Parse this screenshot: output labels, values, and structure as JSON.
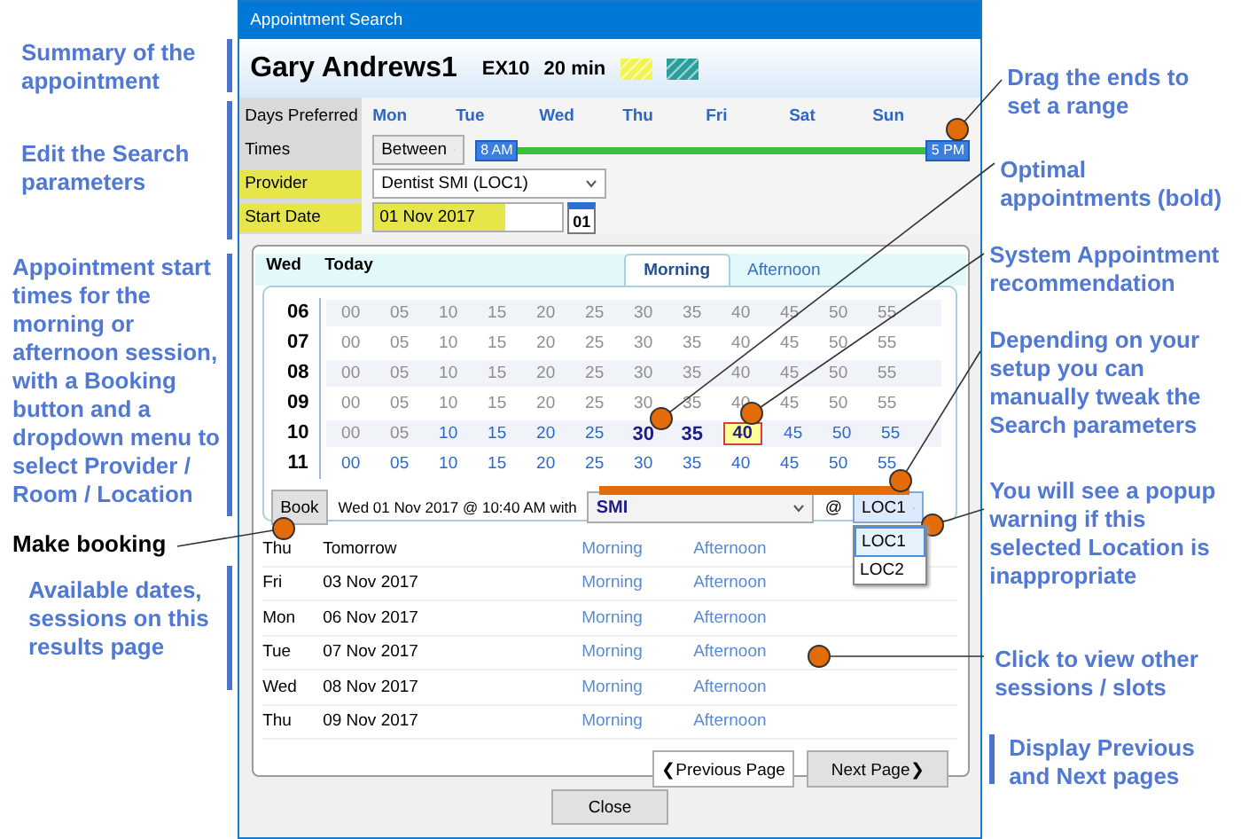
{
  "window": {
    "title": "Appointment Search"
  },
  "summary": {
    "patient": "Gary Andrews1",
    "code": "EX10",
    "duration": "20 min",
    "swatches": [
      {
        "color": "#f2f250"
      },
      {
        "color": "#2a9d9d"
      }
    ]
  },
  "parameters": {
    "days_label": "Days Preferred",
    "days": [
      "Mon",
      "Tue",
      "Wed",
      "Thu",
      "Fri",
      "Sat",
      "Sun"
    ],
    "times_label": "Times",
    "times_mode": "Between",
    "range_start": "8 AM",
    "range_end": "5 PM",
    "provider_label": "Provider",
    "provider_value": "Dentist SMI (LOC1)",
    "provider_highlighted": true,
    "start_date_label": "Start Date",
    "start_date_value": "01 Nov 2017",
    "start_date_highlighted": true,
    "calendar_day": "01"
  },
  "results": {
    "day": "Wed",
    "day_note": "Today",
    "tabs": [
      {
        "label": "Morning",
        "selected": true
      },
      {
        "label": "Afternoon",
        "selected": false
      }
    ],
    "slot_rows": [
      {
        "hour": "06",
        "slots": [
          {
            "minute": "00",
            "kind": "unavailable"
          },
          {
            "minute": "05",
            "kind": "unavailable"
          },
          {
            "minute": "10",
            "kind": "unavailable"
          },
          {
            "minute": "15",
            "kind": "unavailable"
          },
          {
            "minute": "20",
            "kind": "unavailable"
          },
          {
            "minute": "25",
            "kind": "unavailable"
          },
          {
            "minute": "30",
            "kind": "unavailable"
          },
          {
            "minute": "35",
            "kind": "unavailable"
          },
          {
            "minute": "40",
            "kind": "unavailable"
          },
          {
            "minute": "45",
            "kind": "unavailable"
          },
          {
            "minute": "50",
            "kind": "unavailable"
          },
          {
            "minute": "55",
            "kind": "unavailable"
          }
        ]
      },
      {
        "hour": "07",
        "slots": [
          {
            "minute": "00",
            "kind": "unavailable"
          },
          {
            "minute": "05",
            "kind": "unavailable"
          },
          {
            "minute": "10",
            "kind": "unavailable"
          },
          {
            "minute": "15",
            "kind": "unavailable"
          },
          {
            "minute": "20",
            "kind": "unavailable"
          },
          {
            "minute": "25",
            "kind": "unavailable"
          },
          {
            "minute": "30",
            "kind": "unavailable"
          },
          {
            "minute": "35",
            "kind": "unavailable"
          },
          {
            "minute": "40",
            "kind": "unavailable"
          },
          {
            "minute": "45",
            "kind": "unavailable"
          },
          {
            "minute": "50",
            "kind": "unavailable"
          },
          {
            "minute": "55",
            "kind": "unavailable"
          }
        ]
      },
      {
        "hour": "08",
        "slots": [
          {
            "minute": "00",
            "kind": "unavailable"
          },
          {
            "minute": "05",
            "kind": "unavailable"
          },
          {
            "minute": "10",
            "kind": "unavailable"
          },
          {
            "minute": "15",
            "kind": "unavailable"
          },
          {
            "minute": "20",
            "kind": "unavailable"
          },
          {
            "minute": "25",
            "kind": "unavailable"
          },
          {
            "minute": "30",
            "kind": "unavailable"
          },
          {
            "minute": "35",
            "kind": "unavailable"
          },
          {
            "minute": "40",
            "kind": "unavailable"
          },
          {
            "minute": "45",
            "kind": "unavailable"
          },
          {
            "minute": "50",
            "kind": "unavailable"
          },
          {
            "minute": "55",
            "kind": "unavailable"
          }
        ]
      },
      {
        "hour": "09",
        "slots": [
          {
            "minute": "00",
            "kind": "unavailable"
          },
          {
            "minute": "05",
            "kind": "unavailable"
          },
          {
            "minute": "10",
            "kind": "unavailable"
          },
          {
            "minute": "15",
            "kind": "unavailable"
          },
          {
            "minute": "20",
            "kind": "unavailable"
          },
          {
            "minute": "25",
            "kind": "unavailable"
          },
          {
            "minute": "30",
            "kind": "unavailable"
          },
          {
            "minute": "35",
            "kind": "unavailable"
          },
          {
            "minute": "40",
            "kind": "unavailable"
          },
          {
            "minute": "45",
            "kind": "unavailable"
          },
          {
            "minute": "50",
            "kind": "unavailable"
          },
          {
            "minute": "55",
            "kind": "unavailable"
          }
        ]
      },
      {
        "hour": "10",
        "slots": [
          {
            "minute": "00",
            "kind": "unavailable"
          },
          {
            "minute": "05",
            "kind": "unavailable"
          },
          {
            "minute": "10",
            "kind": "available"
          },
          {
            "minute": "15",
            "kind": "available"
          },
          {
            "minute": "20",
            "kind": "available"
          },
          {
            "minute": "25",
            "kind": "available"
          },
          {
            "minute": "30",
            "kind": "optimal"
          },
          {
            "minute": "35",
            "kind": "optimal"
          },
          {
            "minute": "40",
            "kind": "recommended"
          },
          {
            "minute": "45",
            "kind": "available"
          },
          {
            "minute": "50",
            "kind": "available"
          },
          {
            "minute": "55",
            "kind": "available"
          }
        ]
      },
      {
        "hour": "11",
        "slots": [
          {
            "minute": "00",
            "kind": "available"
          },
          {
            "minute": "05",
            "kind": "available"
          },
          {
            "minute": "10",
            "kind": "available"
          },
          {
            "minute": "15",
            "kind": "available"
          },
          {
            "minute": "20",
            "kind": "available"
          },
          {
            "minute": "25",
            "kind": "available"
          },
          {
            "minute": "30",
            "kind": "available"
          },
          {
            "minute": "35",
            "kind": "available"
          },
          {
            "minute": "40",
            "kind": "available"
          },
          {
            "minute": "45",
            "kind": "available"
          },
          {
            "minute": "50",
            "kind": "available"
          },
          {
            "minute": "55",
            "kind": "available"
          }
        ]
      }
    ],
    "booking": {
      "button": "Book",
      "summary": "Wed 01 Nov 2017 @ 10:40 AM with",
      "provider": "SMI",
      "at": "@",
      "location": "LOC1",
      "location_options": [
        {
          "label": "LOC1",
          "selected": true
        },
        {
          "label": "LOC2",
          "selected": false
        }
      ]
    },
    "dates": [
      {
        "day": "Thu",
        "date": "Tomorrow",
        "sessions": [
          "Morning",
          "Afternoon"
        ]
      },
      {
        "day": "Fri",
        "date": "03 Nov 2017",
        "sessions": [
          "Morning",
          "Afternoon"
        ]
      },
      {
        "day": "Mon",
        "date": "06 Nov 2017",
        "sessions": [
          "Morning",
          "Afternoon"
        ]
      },
      {
        "day": "Tue",
        "date": "07 Nov 2017",
        "sessions": [
          "Morning",
          "Afternoon"
        ]
      },
      {
        "day": "Wed",
        "date": "08 Nov 2017",
        "sessions": [
          "Morning",
          "Afternoon"
        ]
      },
      {
        "day": "Thu",
        "date": "09 Nov 2017",
        "sessions": [
          "Morning",
          "Afternoon"
        ]
      }
    ],
    "previous": "❮Previous Page",
    "next": "Next Page❯"
  },
  "close": "Close",
  "annotations_left": [
    {
      "text": "Summary of the appointment",
      "kind": "bracketed"
    },
    {
      "text": "Edit the Search parameters",
      "kind": "bracketed"
    },
    {
      "text": "Appointment start times for the morning or afternoon session, with a Booking button and a dropdown menu to select Provider / Room / Location",
      "kind": "bracketed"
    },
    {
      "text": "Make booking",
      "kind": "label"
    },
    {
      "text": "Available dates, sessions on this results page",
      "kind": "bracketed"
    }
  ],
  "annotations_right": [
    {
      "text": "Drag the ends to set a range",
      "kind": "note"
    },
    {
      "text": "Optimal appointments (**bold**)",
      "kind": "note"
    },
    {
      "text": "System Appointment recommendation",
      "kind": "note"
    },
    {
      "text": "Depending on your setup you can manually tweak the Search parameters",
      "kind": "note"
    },
    {
      "text": "You will see a popup warning if this selected Location is inappropriate",
      "kind": "note"
    },
    {
      "text": "Click to view other sessions / slots",
      "kind": "note"
    },
    {
      "text": "Display Previous and Next pages",
      "kind": "bracketed"
    }
  ]
}
